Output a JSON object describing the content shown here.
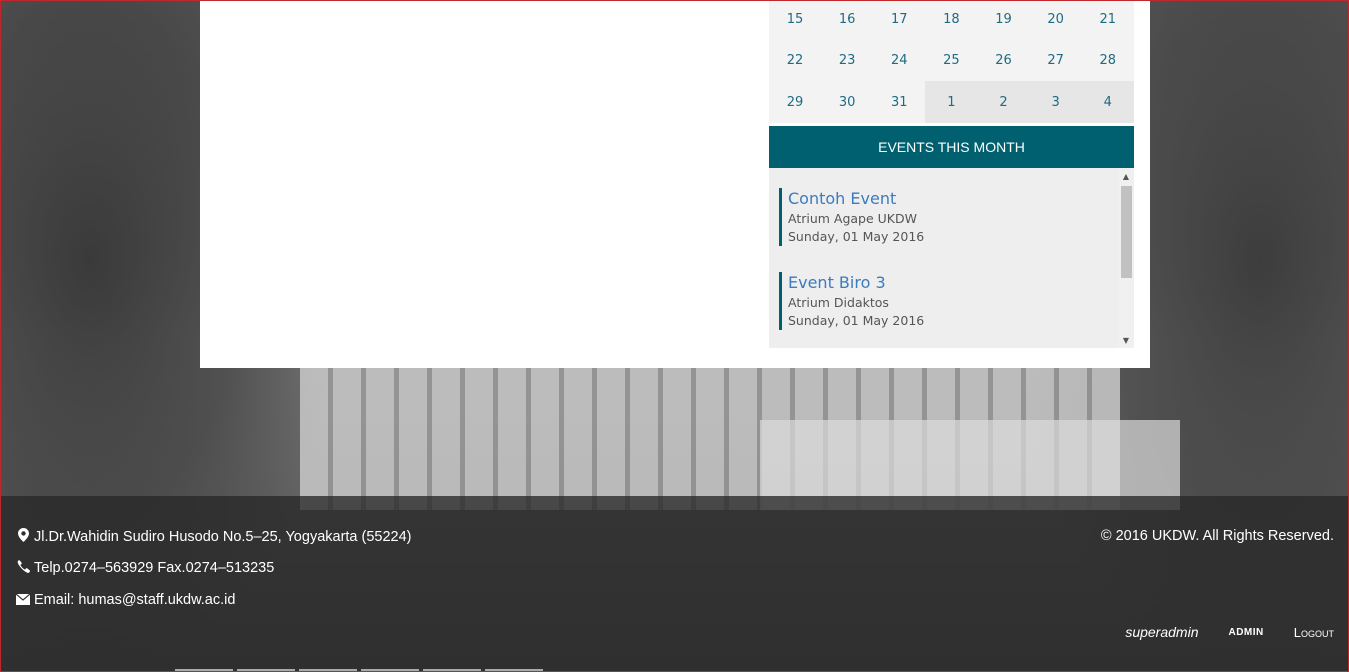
{
  "calendar": {
    "rows": [
      [
        {
          "d": "15"
        },
        {
          "d": "16"
        },
        {
          "d": "17"
        },
        {
          "d": "18"
        },
        {
          "d": "19"
        },
        {
          "d": "20"
        },
        {
          "d": "21"
        }
      ],
      [
        {
          "d": "22"
        },
        {
          "d": "23"
        },
        {
          "d": "24"
        },
        {
          "d": "25"
        },
        {
          "d": "26"
        },
        {
          "d": "27"
        },
        {
          "d": "28"
        }
      ],
      [
        {
          "d": "29"
        },
        {
          "d": "30"
        },
        {
          "d": "31"
        },
        {
          "d": "1",
          "next": true
        },
        {
          "d": "2",
          "next": true
        },
        {
          "d": "3",
          "next": true
        },
        {
          "d": "4",
          "next": true
        }
      ]
    ]
  },
  "events": {
    "header": "EVENTS THIS MONTH",
    "items": [
      {
        "title": "Contoh Event",
        "location": "Atrium Agape UKDW",
        "date": "Sunday, 01 May 2016"
      },
      {
        "title": "Event Biro 3",
        "location": "Atrium Didaktos",
        "date": "Sunday, 01 May 2016"
      }
    ]
  },
  "footer": {
    "address": "Jl.Dr.Wahidin Sudiro Husodo No.5–25, Yogyakarta (55224)",
    "phone": "Telp.0274–563929 Fax.0274–513235",
    "email": "Email: humas@staff.ukdw.ac.id",
    "copyright": "© 2016 UKDW. All Rights Reserved.",
    "icons": {
      "address": "map-marker-icon",
      "phone": "phone-icon",
      "email": "envelope-icon"
    }
  },
  "admin": {
    "user": "superadmin",
    "role": "ADMIN",
    "logout": "Logout"
  },
  "colors": {
    "accent": "#00606f",
    "link": "#3b7bbf",
    "calendar_text": "#1f6b82"
  }
}
